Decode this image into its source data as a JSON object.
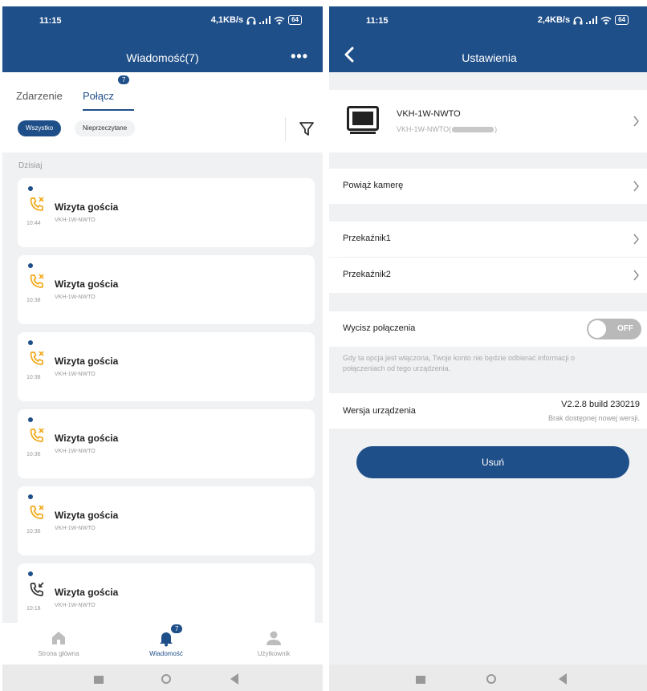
{
  "colors": {
    "primary": "#1f4f89",
    "call_icon": "#f2a818",
    "background": "#f0f1f3"
  },
  "left": {
    "status": {
      "time": "11:15",
      "speed": "4,1KB/s",
      "battery": "64"
    },
    "title": "Wiadomość(7)",
    "menu_icon": "more-dots-icon",
    "tabs": [
      {
        "label": "Zdarzenie"
      },
      {
        "label": "Połącz",
        "badge": "7"
      }
    ],
    "filters": {
      "all": "Wszystko",
      "unread": "Nieprzeczytane"
    },
    "filter_icon": "funnel-icon",
    "section": "Dzisiaj",
    "messages": [
      {
        "title": "Wizyta gościa",
        "time": "10:44",
        "device": "VKH-1W-NWTO",
        "icon": "missed-call-icon"
      },
      {
        "title": "Wizyta gościa",
        "time": "10:38",
        "device": "VKH-1W-NWTO",
        "icon": "missed-call-icon"
      },
      {
        "title": "Wizyta gościa",
        "time": "10:38",
        "device": "VKH-1W-NWTO",
        "icon": "missed-call-icon"
      },
      {
        "title": "Wizyta gościa",
        "time": "10:36",
        "device": "VKH-1W-NWTO",
        "icon": "missed-call-icon"
      },
      {
        "title": "Wizyta gościa",
        "time": "10:36",
        "device": "VKH-1W-NWTO",
        "icon": "missed-call-icon"
      },
      {
        "title": "Wizyta gościa",
        "time": "10:18",
        "device": "VKH-1W-NWTO",
        "icon": "incoming-call-icon"
      }
    ],
    "nav": {
      "home": "Strona główna",
      "messages": "Wiadomość",
      "messages_badge": "7",
      "user": "Użytkownik"
    }
  },
  "right": {
    "status": {
      "time": "11:15",
      "speed": "2,4KB/s",
      "battery": "64"
    },
    "title": "Ustawienia",
    "device": {
      "name": "VKH-1W-NWTO",
      "sub": "VKH-1W-NWTO(",
      "sub_end": ")"
    },
    "link_camera": "Powiąż kamerę",
    "relay1": "Przekaźnik1",
    "relay2": "Przekaźnik2",
    "mute": {
      "label": "Wycisz połączenia",
      "state": "OFF",
      "note": "Gdy ta opcja jest włączona, Twoje konto nie będzie odbierać informacji o połączeniach od tego urządzenia."
    },
    "version": {
      "label": "Wersja urządzenia",
      "value": "V2.2.8 build 230219",
      "status": "Brak dostępnej nowej wersji."
    },
    "delete": "Usuń"
  }
}
